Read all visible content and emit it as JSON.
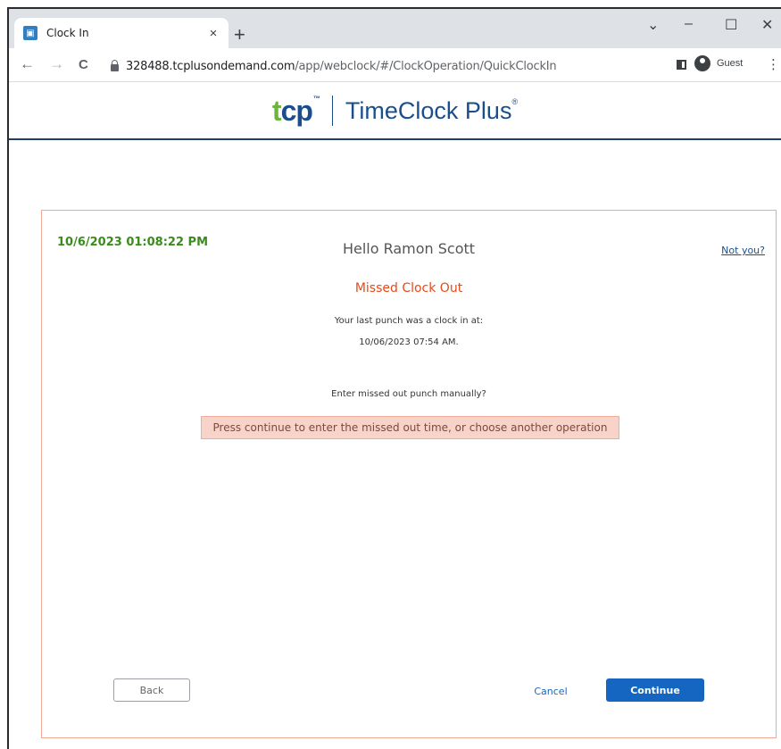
{
  "browser": {
    "tab_title": "Clock In",
    "tab_close": "×",
    "new_tab": "+",
    "url_host": "328488.tcplusondemand.com",
    "url_path": "/app/webclock/#/ClockOperation/QuickClockIn",
    "profile_label": "Guest",
    "controls": {
      "dropdown": "⌄",
      "minimize": "–",
      "maximize": "☐",
      "close": "✕",
      "back": "←",
      "forward": "→",
      "reload": "C",
      "menu": "⋮"
    }
  },
  "brand": {
    "logo_short": "cp",
    "logo_t": "t",
    "logo_tm": "™",
    "logo_name": "TimeClock Plus",
    "logo_reg": "®",
    "color": "#1b4f8c",
    "accent": "#6cb33f"
  },
  "clock": {
    "datetime": "10/6/2023 01:08:22 PM",
    "greeting": "Hello Ramon Scott",
    "not_you": "Not you?",
    "status_title": "Missed Clock Out",
    "last_punch_label": "Your last punch was a clock in at:",
    "last_punch_time": "10/06/2023 07:54 AM.",
    "question": "Enter missed out punch manually?",
    "notice": "Press continue to enter the missed out time, or choose another operation"
  },
  "actions": {
    "back": "Back",
    "cancel": "Cancel",
    "continue": "Continue"
  },
  "colors": {
    "datetime": "#3a8c1c",
    "alert": "#e64a19",
    "notice_bg": "#f8d3c9",
    "primary": "#1466c0"
  }
}
